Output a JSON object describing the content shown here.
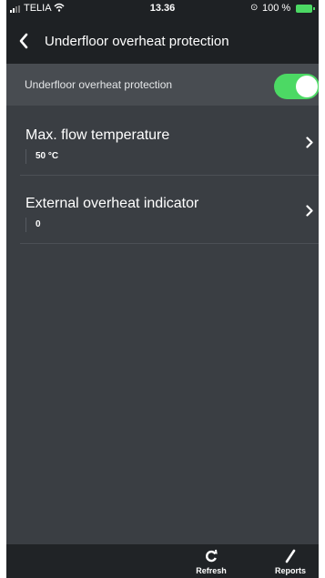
{
  "status_bar": {
    "carrier": "TELIA",
    "time": "13.36",
    "battery": "100 %"
  },
  "header": {
    "title": "Underfloor overheat protection"
  },
  "toggle": {
    "label": "Underfloor overheat protection",
    "enabled": true
  },
  "items": [
    {
      "title": "Max. flow temperature",
      "value": "50 °C"
    },
    {
      "title": "External overheat indicator",
      "value": "0"
    }
  ],
  "tab_bar": {
    "refresh_label": "Refresh",
    "reports_label": "Reports"
  },
  "colors": {
    "toggle_on": "#4cd964",
    "background": "#3a3e43",
    "header": "#1e2124"
  },
  "icons": [
    "back-chevron-icon",
    "chevron-right-icon",
    "refresh-icon",
    "pencil-icon",
    "wifi-icon",
    "battery-icon",
    "alarm-icon"
  ]
}
